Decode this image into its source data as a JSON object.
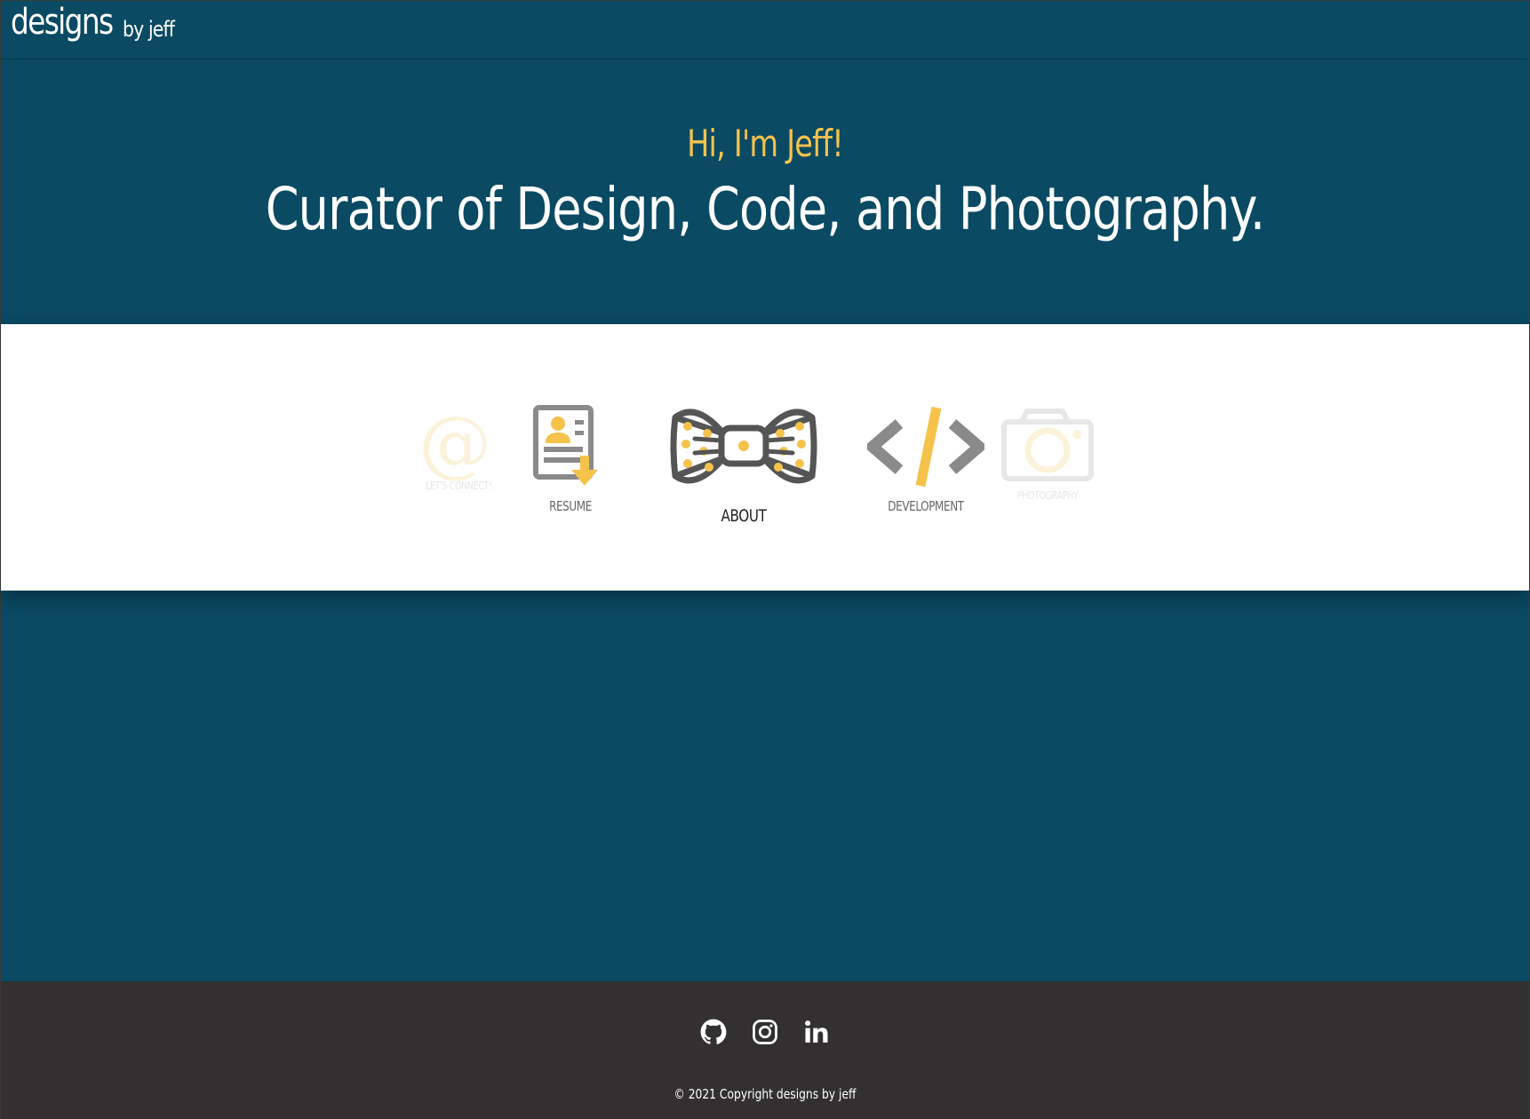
{
  "brand": {
    "main": "designs",
    "sub": "by jeff"
  },
  "hero": {
    "greeting": "Hi, I'm Jeff!",
    "tagline": "Curator of Design, Code, and Photography."
  },
  "nav": {
    "connect": {
      "label": "LET'S CONNECT!",
      "glyph": "@",
      "icon": "at-icon"
    },
    "resume": {
      "label": "RESUME",
      "icon": "resume-download-icon"
    },
    "about": {
      "label": "ABOUT",
      "icon": "bowtie-icon"
    },
    "development": {
      "label": "DEVELOPMENT",
      "icon": "code-brackets-icon"
    },
    "photography": {
      "label": "PHOTOGRAPHY",
      "icon": "camera-icon"
    }
  },
  "footer": {
    "social": [
      "github-icon",
      "instagram-icon",
      "linkedin-icon"
    ],
    "copyright": "© 2021 Copyright designs by jeff"
  },
  "colors": {
    "header_bg": "#0a4a63",
    "accent": "#f5c24c",
    "footer_bg": "#323031",
    "icon_gray": "#666666"
  }
}
